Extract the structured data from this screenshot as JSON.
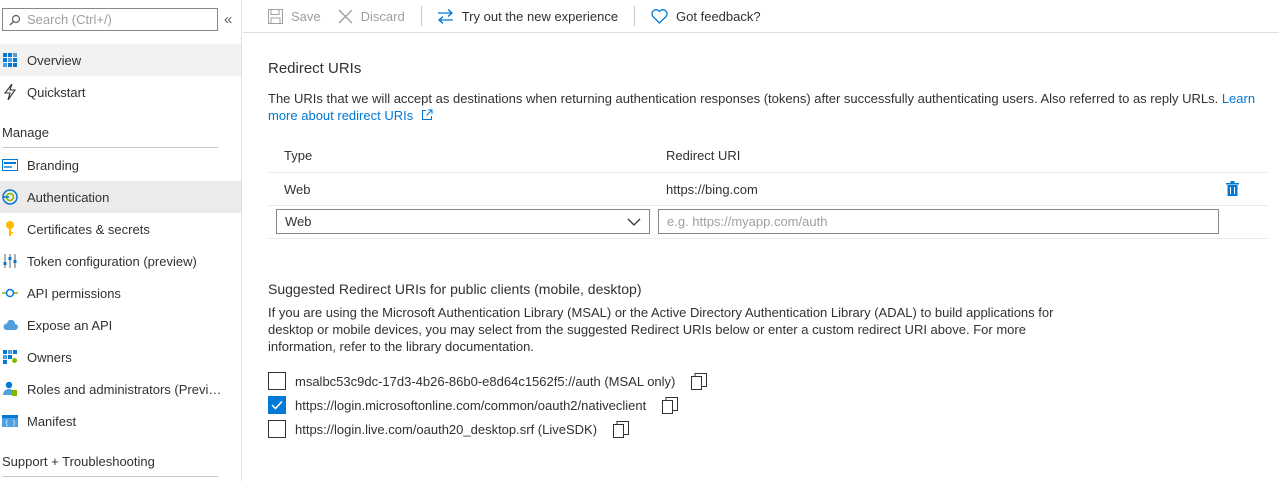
{
  "sidebar": {
    "search_placeholder": "Search (Ctrl+/)",
    "collapse_label": "«",
    "items": [
      {
        "label": "Overview",
        "icon": "overview-icon"
      },
      {
        "label": "Quickstart",
        "icon": "quickstart-icon"
      }
    ],
    "manage_heading": "Manage",
    "manage_items": [
      {
        "label": "Branding",
        "icon": "branding-icon"
      },
      {
        "label": "Authentication",
        "icon": "authentication-icon"
      },
      {
        "label": "Certificates & secrets",
        "icon": "key-icon"
      },
      {
        "label": "Token configuration (preview)",
        "icon": "token-icon"
      },
      {
        "label": "API permissions",
        "icon": "api-permissions-icon"
      },
      {
        "label": "Expose an API",
        "icon": "cloud-icon"
      },
      {
        "label": "Owners",
        "icon": "owners-icon"
      },
      {
        "label": "Roles and administrators (Preview)",
        "icon": "roles-icon"
      },
      {
        "label": "Manifest",
        "icon": "manifest-icon"
      }
    ],
    "support_heading": "Support + Troubleshooting",
    "active": "Authentication"
  },
  "toolbar": {
    "save_label": "Save",
    "discard_label": "Discard",
    "try_label": "Try out the new experience",
    "feedback_label": "Got feedback?"
  },
  "redirect": {
    "title": "Redirect URIs",
    "description": "The URIs that we will accept as destinations when returning authentication responses (tokens) after successfully authenticating users. Also referred to as reply URLs.",
    "learn_more": "Learn more about redirect URIs",
    "col_type": "Type",
    "col_uri": "Redirect URI",
    "rows": [
      {
        "type": "Web",
        "uri": "https://bing.com"
      }
    ],
    "new_type": "Web",
    "new_uri_placeholder": "e.g. https://myapp.com/auth"
  },
  "suggested": {
    "title": "Suggested Redirect URIs for public clients (mobile, desktop)",
    "description": "If you are using the Microsoft Authentication Library (MSAL) or the Active Directory Authentication Library (ADAL) to build applications for desktop or mobile devices, you may select from the suggested Redirect URIs below or enter a custom redirect URI above. For more information, refer to the library documentation.",
    "options": [
      {
        "label": "msalbc53c9dc-17d3-4b26-86b0-e8d64c1562f5://auth (MSAL only)",
        "checked": false
      },
      {
        "label": "https://login.microsoftonline.com/common/oauth2/nativeclient",
        "checked": true
      },
      {
        "label": "https://login.live.com/oauth20_desktop.srf (LiveSDK)",
        "checked": false
      }
    ]
  },
  "colors": {
    "accent": "#0078d4",
    "active_bg": "#edebe9",
    "border": "#8a8886"
  }
}
